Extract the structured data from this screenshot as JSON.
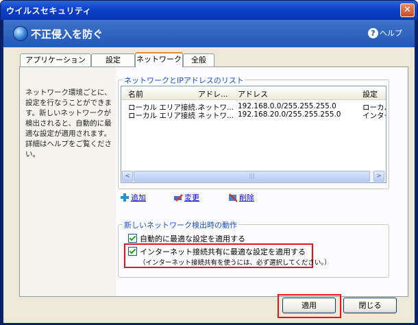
{
  "window": {
    "title": "ウイルスセキュリティ",
    "close_glyph": "✕"
  },
  "header": {
    "title": "不正侵入を防ぐ",
    "help_label": "ヘルプ",
    "help_glyph": "?"
  },
  "tabs": [
    {
      "label": "アプリケーション"
    },
    {
      "label": "設定"
    },
    {
      "label": "ネットワーク",
      "active": true
    },
    {
      "label": "全般"
    }
  ],
  "description": "ネットワーク環境ごとに、設定を行なうことができます。新しいネットワークが検出されると、自動的に最適な設定が適用されます。詳細はヘルプをご覧ください。",
  "network_list": {
    "group_label": "ネットワークとIPアドレスのリスト",
    "columns": [
      "名前",
      "アドレ...",
      "アドレス",
      "設定"
    ],
    "rows": [
      [
        "ローカル エリア接続...",
        "ネットワ...",
        "192.168.0.0/255.255.255.0",
        "ローカル"
      ],
      [
        "ローカル エリア接続",
        "ネットワ...",
        "192.168.20.0/255.255.255.0",
        "インター"
      ]
    ],
    "scroll_left_glyph": "<",
    "scroll_right_glyph": ">",
    "thumb_grip": "|||"
  },
  "actions": {
    "add": "追加",
    "edit": "変更",
    "delete": "削除"
  },
  "detection": {
    "group_label": "新しいネットワーク検出時の動作",
    "option1": "自動的に最適な設定を適用する",
    "option2": "インターネット接続共有に最適な設定を適用する",
    "option2_note": "（インターネット接続共有を使うには、必ず選択してください。）"
  },
  "buttons": {
    "apply": "適用",
    "close": "閉じる"
  },
  "colors": {
    "highlight": "#e8121f",
    "link": "#0000ee",
    "group_label": "#1a4fc0"
  }
}
